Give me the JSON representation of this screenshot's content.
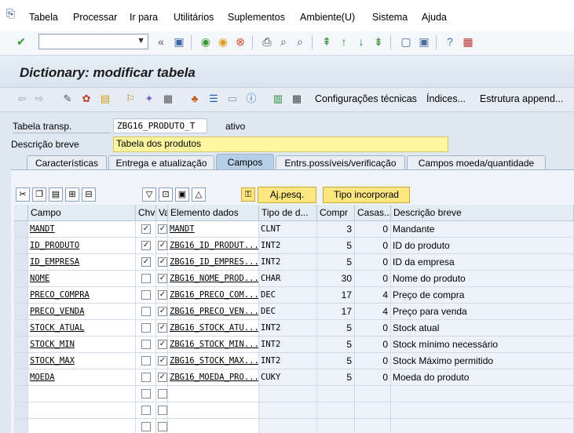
{
  "menu": {
    "items": [
      "Tabela",
      "Processar",
      "Ir para",
      "Utilitários",
      "Suplementos",
      "Ambiente(U)",
      "Sistema",
      "Ajuda"
    ]
  },
  "toolbar": {
    "command_value": "",
    "icons": [
      "enter-check-icon",
      "back-icon",
      "save-icon",
      "back-arrow-icon",
      "exit-icon",
      "cancel-icon",
      "print-icon",
      "find-icon",
      "find-next-icon",
      "first-page-icon",
      "prev-page-icon",
      "next-page-icon",
      "last-page-icon",
      "new-session-icon",
      "shortcut-icon",
      "help-icon",
      "layout-icon"
    ]
  },
  "title": "Dictionary: modificar tabela",
  "app_toolbar": {
    "technical_settings": "Configurações técnicas",
    "indexes": "Índices...",
    "append_structure": "Estrutura append..."
  },
  "header": {
    "table_label": "Tabela transp.",
    "table_value": "ZBG16_PRODUTO_T",
    "status": "ativo",
    "desc_label": "Descrição breve",
    "desc_value": "Tabela dos produtos"
  },
  "tabs": [
    {
      "label": "Características",
      "active": false
    },
    {
      "label": "Entrega e atualização",
      "active": false
    },
    {
      "label": "Campos",
      "active": true
    },
    {
      "label": "Entrs.possíveis/verificação",
      "active": false
    },
    {
      "label": "Campos moeda/quantidade",
      "active": false
    }
  ],
  "field_buttons": {
    "search_help": "Aj.pesq.",
    "builtin_type": "Tipo incorporad"
  },
  "grid": {
    "columns": [
      "Campo",
      "Chv",
      "Val...",
      "Elemento dados",
      "Tipo de d...",
      "Compr",
      "Casas...",
      "Descrição breve"
    ],
    "rows": [
      {
        "field": "MANDT",
        "key": true,
        "init": true,
        "element": "MANDT",
        "type": "CLNT",
        "length": "3",
        "decimals": "0",
        "desc": "Mandante"
      },
      {
        "field": "ID_PRODUTO",
        "key": true,
        "init": true,
        "element": "ZBG16_ID_PRODUT...",
        "type": "INT2",
        "length": "5",
        "decimals": "0",
        "desc": "ID do produto"
      },
      {
        "field": "ID_EMPRESA",
        "key": true,
        "init": true,
        "element": "ZBG16_ID_EMPRES...",
        "type": "INT2",
        "length": "5",
        "decimals": "0",
        "desc": "ID da empresa"
      },
      {
        "field": "NOME",
        "key": false,
        "init": true,
        "element": "ZBG16_NOME_PROD...",
        "type": "CHAR",
        "length": "30",
        "decimals": "0",
        "desc": "Nome do produto"
      },
      {
        "field": "PRECO_COMPRA",
        "key": false,
        "init": true,
        "element": "ZBG16_PRECO_COM...",
        "type": "DEC",
        "length": "17",
        "decimals": "4",
        "desc": "Preço de compra"
      },
      {
        "field": "PRECO_VENDA",
        "key": false,
        "init": true,
        "element": "ZBG16_PRECO_VEN...",
        "type": "DEC",
        "length": "17",
        "decimals": "4",
        "desc": "Preço para venda"
      },
      {
        "field": "STOCK_ATUAL",
        "key": false,
        "init": true,
        "element": "ZBG16_STOCK_ATU...",
        "type": "INT2",
        "length": "5",
        "decimals": "0",
        "desc": "Stock atual"
      },
      {
        "field": "STOCK_MIN",
        "key": false,
        "init": true,
        "element": "ZBG16_STOCK_MIN...",
        "type": "INT2",
        "length": "5",
        "decimals": "0",
        "desc": "Stock mínimo necessário"
      },
      {
        "field": "STOCK_MAX",
        "key": false,
        "init": true,
        "element": "ZBG16_STOCK_MAX...",
        "type": "INT2",
        "length": "5",
        "decimals": "0",
        "desc": "Stock Máximo permitido"
      },
      {
        "field": "MOEDA",
        "key": false,
        "init": true,
        "element": "ZBG16_MOEDA_PRO...",
        "type": "CUKY",
        "length": "5",
        "decimals": "0",
        "desc": "Moeda do produto"
      },
      {
        "field": "",
        "key": false,
        "init": false,
        "element": "",
        "type": "",
        "length": "",
        "decimals": "",
        "desc": ""
      },
      {
        "field": "",
        "key": false,
        "init": false,
        "element": "",
        "type": "",
        "length": "",
        "decimals": "",
        "desc": ""
      },
      {
        "field": "",
        "key": false,
        "init": false,
        "element": "",
        "type": "",
        "length": "",
        "decimals": "",
        "desc": ""
      }
    ]
  }
}
